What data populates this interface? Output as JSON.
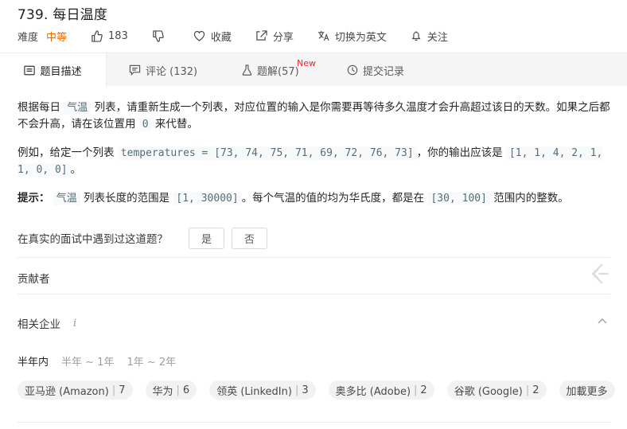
{
  "problem": {
    "title": "739. 每日温度",
    "difficulty_label": "难度",
    "difficulty": "中等",
    "likes": "183",
    "favorite": "收藏",
    "share": "分享",
    "switch_lang": "切换为英文",
    "follow": "关注"
  },
  "tabs": {
    "description": "题目描述",
    "comments": "评论 (132)",
    "solutions": "题解(57)",
    "solutions_badge": "New",
    "submissions": "提交记录"
  },
  "description": {
    "p1_a": "根据每日",
    "p1_code1": "气温",
    "p1_b": "列表，请重新生成一个列表，对应位置的输入是你需要再等待多久温度才会升高超过该日的天数。如果之后都不会升高，请在该位置用",
    "p1_code2": "0",
    "p1_c": "来代替。",
    "p2_a": "例如，给定一个列表",
    "p2_code1": "temperatures = [73, 74, 75, 71, 69, 72, 76, 73]",
    "p2_b": "，你的输出应该是",
    "p2_code2": "[1, 1, 4, 2, 1, 1, 0, 0]",
    "p2_c": "。",
    "hint_label": "提示：",
    "p3_code1": "气温",
    "p3_a": "列表长度的范围是",
    "p3_code2": "[1, 30000]",
    "p3_b": "。每个气温的值的均为华氏度，都是在",
    "p3_code3": "[30, 100]",
    "p3_c": "范围内的整数。"
  },
  "interview": {
    "question": "在真实的面试中遇到过这道题？",
    "yes": "是",
    "no": "否"
  },
  "contributors_label": "贡献者",
  "companies": {
    "label": "相关企业",
    "info": "i",
    "time_tabs": [
      "半年内",
      "半年 ~ 1年",
      "1年 ~ 2年"
    ],
    "chips": [
      {
        "name": "亚马逊 (Amazon)",
        "count": "7"
      },
      {
        "name": "华为",
        "count": "6"
      },
      {
        "name": "领英 (LinkedIn)",
        "count": "3"
      },
      {
        "name": "奥多比 (Adobe)",
        "count": "2"
      },
      {
        "name": "谷歌 (Google)",
        "count": "2"
      }
    ],
    "load_more": "加載更多"
  },
  "colors": {
    "accent": "#ef6c00",
    "new_badge": "#f5222d",
    "code_text": "#546e7a"
  }
}
